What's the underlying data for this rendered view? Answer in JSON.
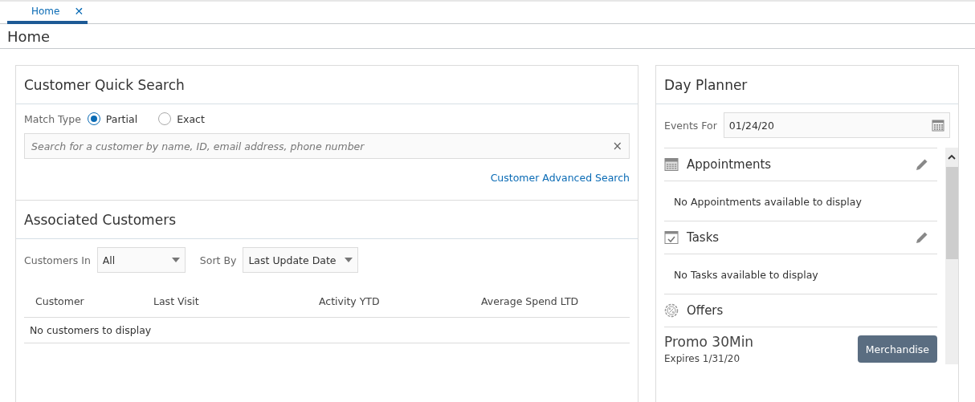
{
  "tabs": [
    {
      "label": "Home",
      "selected": true,
      "close": "✕"
    }
  ],
  "page_title": "Home",
  "quick_search": {
    "title": "Customer Quick Search",
    "match_type_label": "Match Type",
    "options": [
      {
        "label": "Partial",
        "selected": true
      },
      {
        "label": "Exact",
        "selected": false
      }
    ],
    "search": {
      "placeholder": "Search for a customer by name, ID, email address, phone number",
      "clear": "×"
    },
    "advanced_link": "Customer Advanced Search"
  },
  "associated": {
    "title": "Associated Customers",
    "filters": [
      {
        "label": "Customers In",
        "value": "All"
      },
      {
        "label": "Sort By",
        "value": "Last Update Date"
      }
    ],
    "columns": [
      "Customer",
      "Last Visit",
      "Activity YTD",
      "Average Spend LTD"
    ],
    "empty": "No customers to display"
  },
  "day_planner": {
    "title": "Day Planner",
    "events_for_label": "Events For",
    "date": "01/24/20",
    "sections": [
      {
        "kind": "appointments",
        "title": "Appointments",
        "editable": true,
        "empty": "No Appointments available to display"
      },
      {
        "kind": "tasks",
        "title": "Tasks",
        "editable": true,
        "empty": "No Tasks available to display"
      },
      {
        "kind": "offers",
        "title": "Offers",
        "editable": false,
        "offers": [
          {
            "name": "Promo 30Min",
            "expires": "Expires 1/31/20",
            "button": "Merchandise"
          }
        ]
      }
    ]
  }
}
